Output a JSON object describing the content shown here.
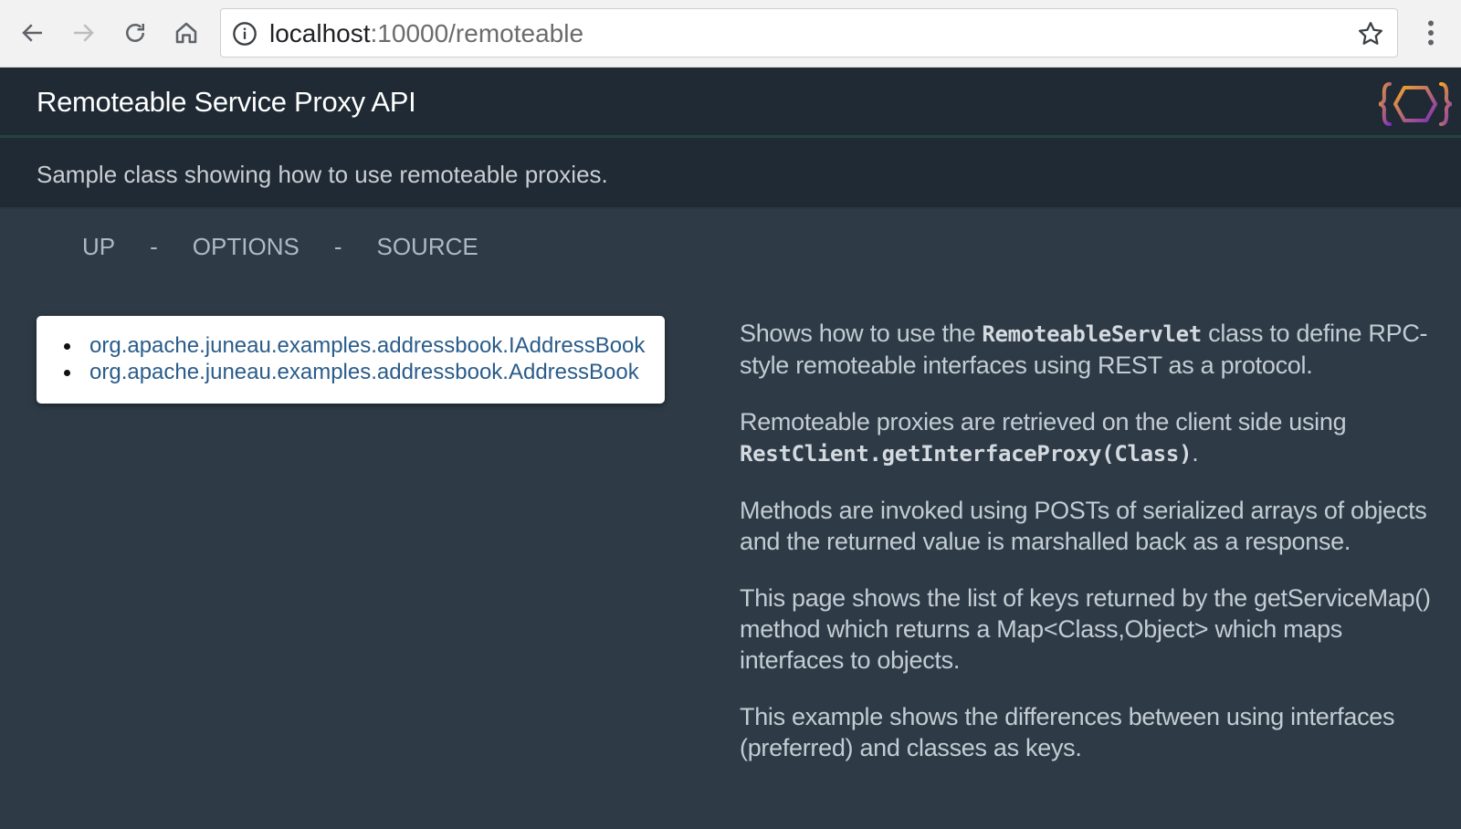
{
  "browser": {
    "url_host": "localhost",
    "url_path": ":10000/remoteable",
    "back_icon": "back-arrow-icon",
    "forward_icon": "forward-arrow-icon",
    "reload_icon": "reload-icon",
    "home_icon": "home-icon"
  },
  "header": {
    "title": "Remoteable Service Proxy API",
    "subtitle": "Sample class showing how to use remoteable proxies."
  },
  "nav": {
    "up": "UP",
    "sep1": "-",
    "options": "OPTIONS",
    "sep2": "-",
    "source": "SOURCE"
  },
  "services": [
    "org.apache.juneau.examples.addressbook.IAddressBook",
    "org.apache.juneau.examples.addressbook.AddressBook"
  ],
  "description": {
    "p1_a": "Shows how to use the ",
    "p1_code": "RemoteableServlet",
    "p1_b": " class to define RPC-style remoteable interfaces using REST as a protocol.",
    "p2_a": "Remoteable proxies are retrieved on the client side using ",
    "p2_code": "RestClient.getInterfaceProxy(Class)",
    "p2_b": ".",
    "p3": "Methods are invoked using POSTs of serialized arrays of objects and the returned value is marshalled back as a response.",
    "p4": "This page shows the list of keys returned by the getServiceMap() method which returns a Map<Class,Object> which maps interfaces to objects.",
    "p5": "This example shows the differences between using interfaces (preferred) and classes as keys."
  },
  "colors": {
    "header_bg": "#1f2a34",
    "body_bg": "#2e3b47",
    "link": "#2a5c8a",
    "logo_orange": "#f5a623",
    "logo_purple": "#7b2fbf"
  }
}
